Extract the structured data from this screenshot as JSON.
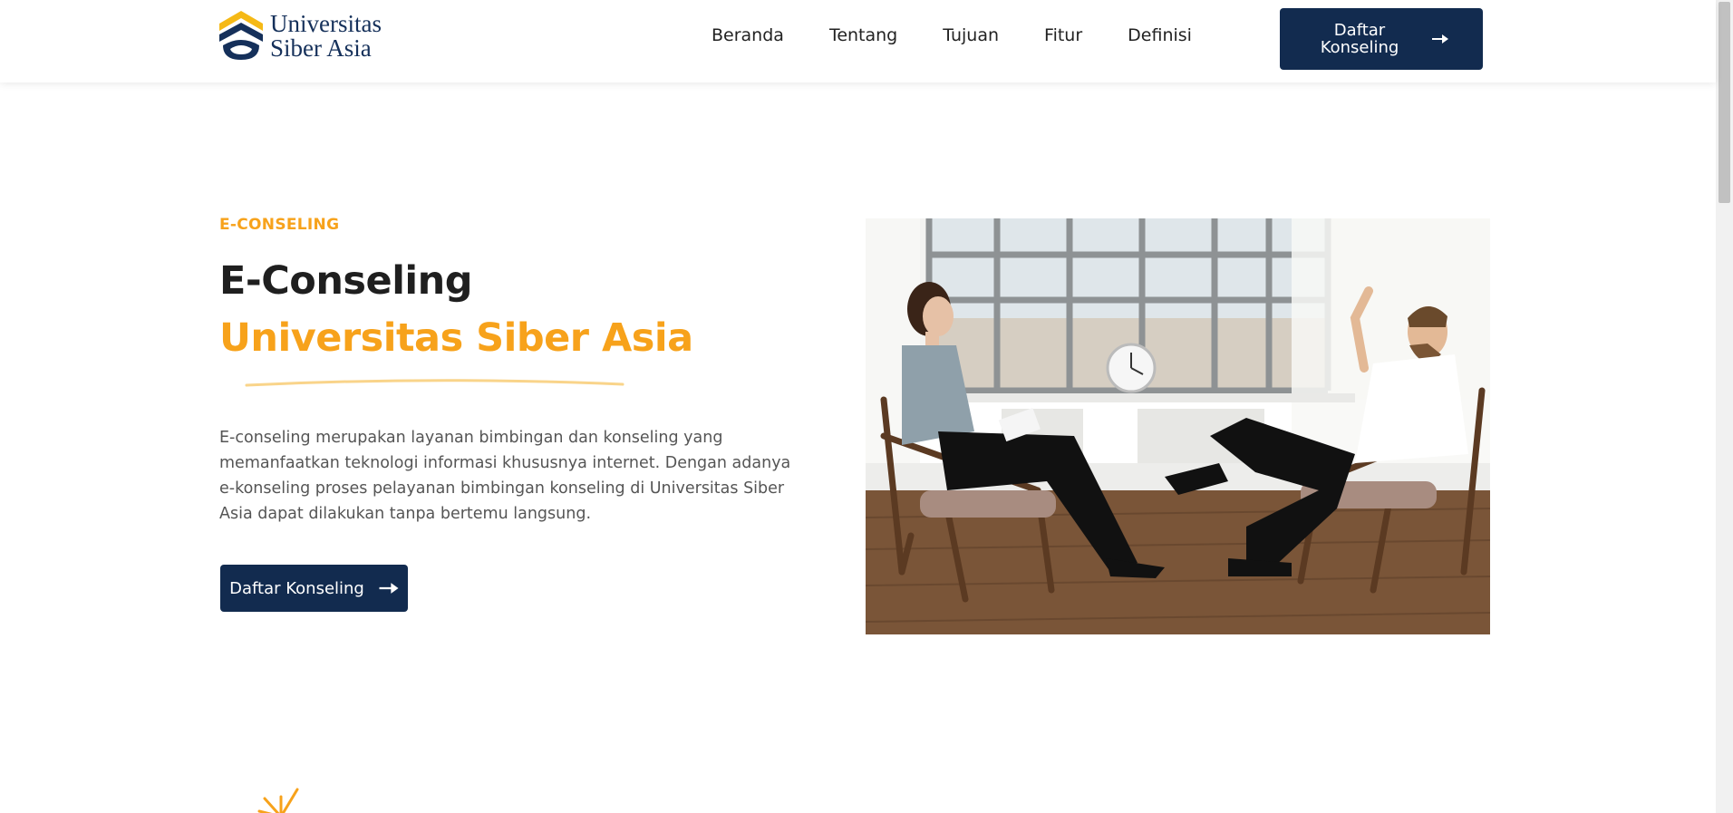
{
  "header": {
    "logo": {
      "line1": "Universitas",
      "line2": "Siber Asia"
    },
    "nav": [
      "Beranda",
      "Tentang",
      "Tujuan",
      "Fitur",
      "Definisi"
    ],
    "cta_label": "Daftar Konseling"
  },
  "hero": {
    "eyebrow": "E-CONSELING",
    "title_line1": "E-Conseling",
    "title_line2": "Universitas Siber Asia",
    "description": "E-conseling merupakan layanan bimbingan dan konseling yang memanfaatkan teknologi informasi khususnya internet. Dengan adanya e-konseling proses pelayanan bimbingan konseling di Universitas Siber Asia dapat dilakukan tanpa bertemu langsung.",
    "cta_label": "Daftar Konseling"
  },
  "colors": {
    "accent": "#f7a21b",
    "navy": "#122b4f"
  },
  "icons": [
    "logo-mark-icon",
    "arrow-right-icon",
    "sparkle-icon"
  ]
}
